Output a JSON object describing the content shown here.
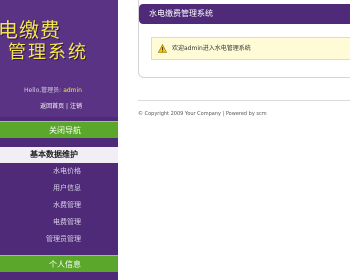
{
  "brand": {
    "line1": "电缴费",
    "line2": "管理系统"
  },
  "user": {
    "greeting": "Hello,管理员:",
    "name": "admin"
  },
  "links": {
    "home": "返回首页",
    "sep": " | ",
    "logout": "注销"
  },
  "nav": {
    "close_nav": "关闭导航",
    "section_title": "基本数据维护",
    "items": [
      {
        "label": "水电价格"
      },
      {
        "label": "用户信息"
      },
      {
        "label": "水费管理"
      },
      {
        "label": "电费管理"
      },
      {
        "label": "管理员管理"
      }
    ],
    "personal": "个人信息"
  },
  "main": {
    "panel_title": "水电缴费管理系统",
    "notice": "欢迎admin进入水电管理系统",
    "footer": "© Copyright 2009 Your Company | Powered by scm"
  },
  "colors": {
    "sidebar": "#4f2a78",
    "nav_green": "#5aa72b",
    "brand_yellow": "#f5e64d",
    "notice_bg": "#fffbd6"
  }
}
